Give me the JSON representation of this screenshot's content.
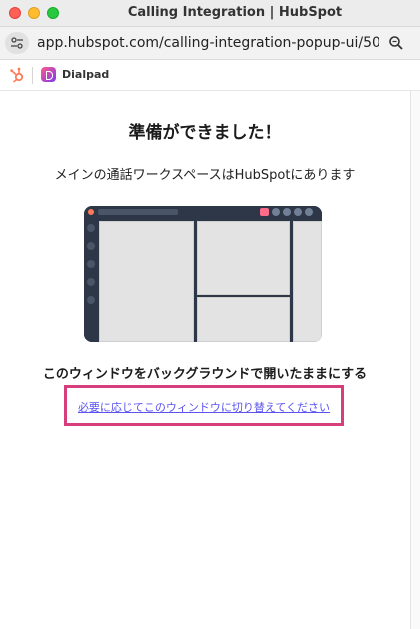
{
  "window": {
    "title": "Calling Integration | HubSpot"
  },
  "urlbar": {
    "url": "app.hubspot.com/calling-integration-popup-ui/50..."
  },
  "brand": {
    "app_name": "Dialpad"
  },
  "content": {
    "heading": "準備ができました！",
    "subtitle": "メインの通話ワークスペースはHubSpotにあります",
    "keep_background": "このウィンドウをバックグラウンドで開いたままにする",
    "switch_link": "必要に応じてこのウィンドウに切り替えてください"
  },
  "colors": {
    "highlight": "#d63f7c",
    "link": "#5b53f0",
    "hubspot": "#ff7a59"
  },
  "icons": {
    "site_settings": "sliders-icon",
    "zoom": "magnifier-icon",
    "hubspot": "hubspot-sprocket-icon",
    "dialpad": "dialpad-logo-icon"
  }
}
